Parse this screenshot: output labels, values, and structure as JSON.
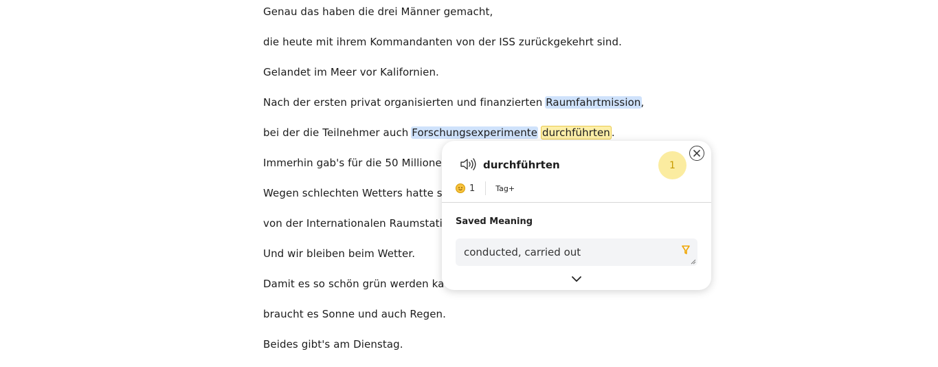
{
  "reader": {
    "lines": [
      {
        "before": "Genau das haben die drei Männer gemacht,"
      },
      {
        "before": "die heute mit ihrem Kommandanten von der ISS zurückgekehrt sind."
      },
      {
        "before": "Gelandet im Meer vor Kalifornien."
      },
      {
        "before": "Nach der ersten privat organisierten und finanzierten ",
        "blue": "Raumfahrtmission",
        "after": ","
      },
      {
        "before": "bei der die Teilnehmer auch ",
        "blue": "Forschungsexperimente",
        "yellow": "durchführten",
        "after": "."
      },
      {
        "before": "Immerhin gab's für die 50 Millione"
      },
      {
        "before": "Wegen schlechten Wetters hatte s"
      },
      {
        "before": "von der Internationalen Raumstati"
      },
      {
        "before": "Und wir bleiben beim Wetter."
      },
      {
        "before": "Damit es so schön grün werden ka"
      },
      {
        "before": "braucht es Sonne und auch Regen."
      },
      {
        "before": "Beides gibt's am Dienstag."
      }
    ]
  },
  "popup": {
    "word": "durchführten",
    "level": "1",
    "status_count": "1",
    "tag_label": "Tag+",
    "saved_meaning_label": "Saved Meaning",
    "saved_meaning_value": "conducted, carried out",
    "icons": {
      "close": "close-icon",
      "speaker": "speaker-icon",
      "status": "smiley-icon",
      "hint": "lightbulb-icon",
      "expand": "chevron-down-icon"
    }
  },
  "colors": {
    "known_word_highlight": "#cfe2fb",
    "selected_word_highlight": "#fdefa8",
    "level_badge": "#fbeca0",
    "accent_yellow": "#f0a500"
  }
}
